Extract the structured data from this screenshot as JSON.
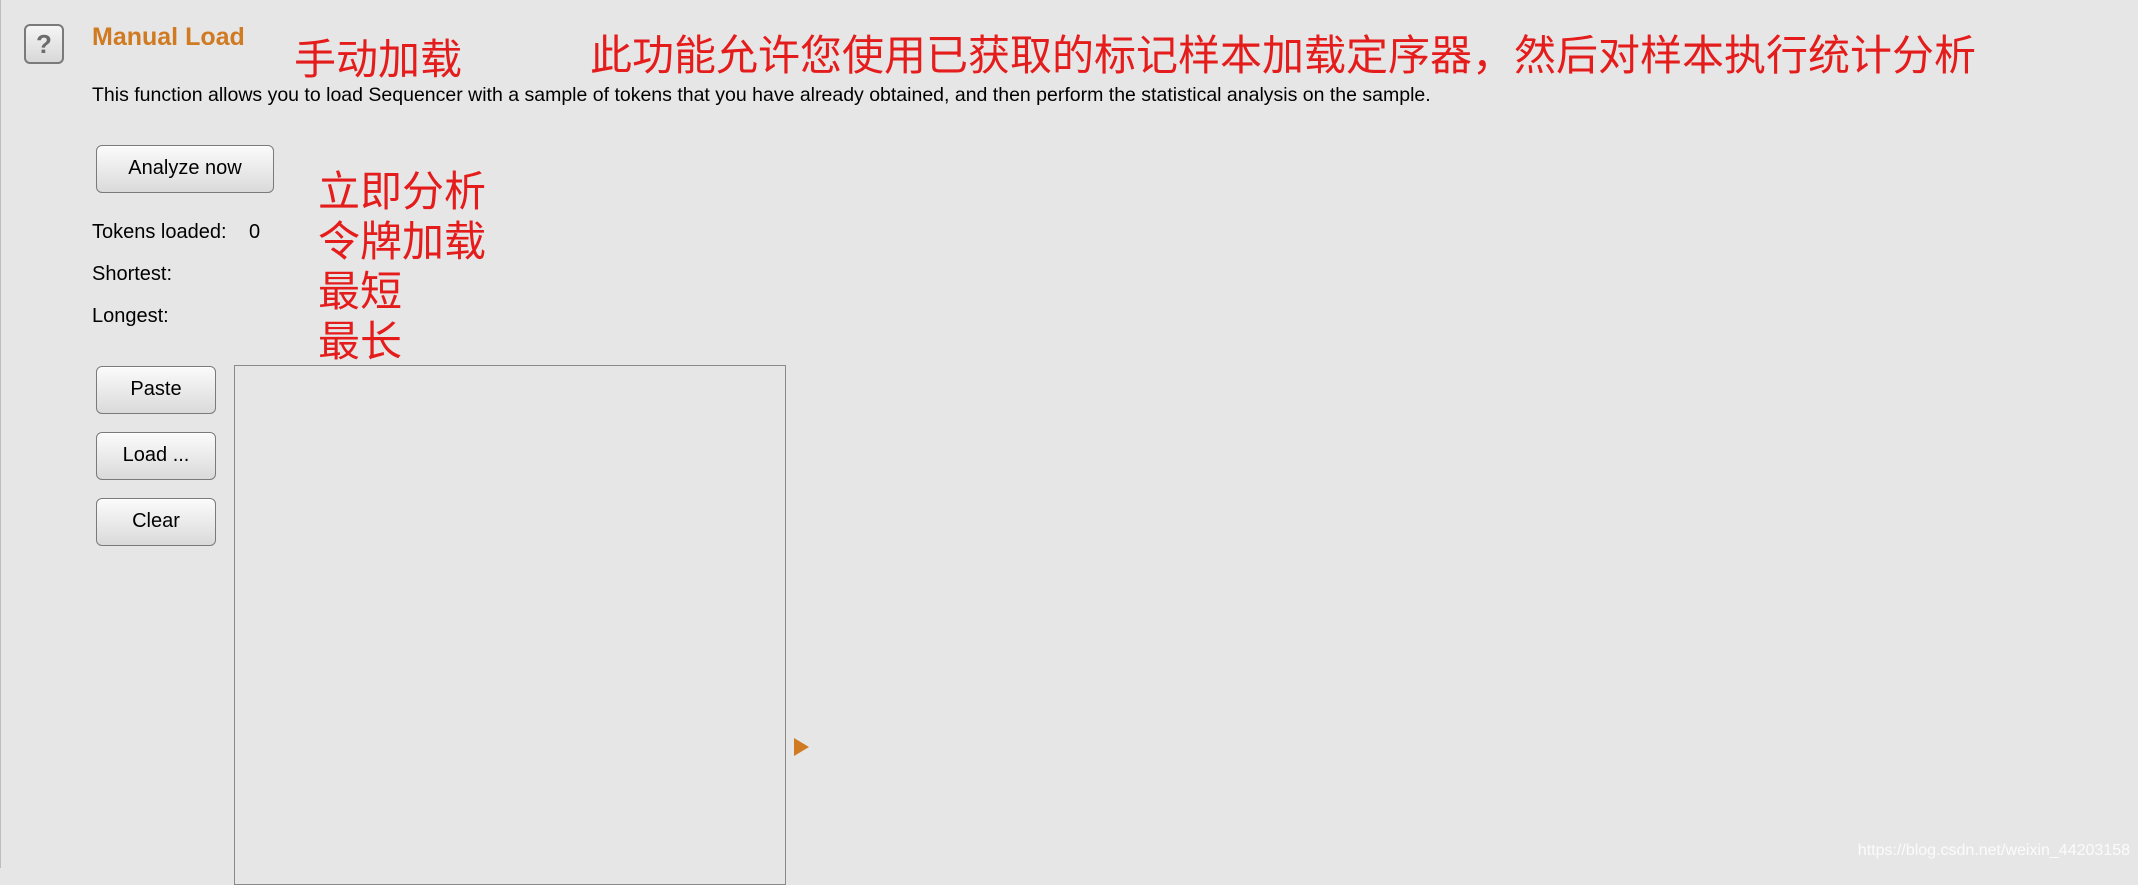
{
  "header": {
    "help_icon_glyph": "?",
    "title": "Manual Load",
    "title_color": "#d07a21",
    "description": "This function allows you to load Sequencer with a sample of tokens that you have already obtained, and then perform the statistical analysis on the sample."
  },
  "annotations": {
    "color": "#e51c1c",
    "title_cn": "手动加载",
    "desc_cn": "此功能允许您使用已获取的标记样本加载定序器，然后对样本执行统计分析",
    "analyze_cn": "立即分析",
    "tokens_cn": "令牌加载",
    "shortest_cn": "最短",
    "longest_cn": "最长"
  },
  "actions": {
    "analyze_label": "Analyze now",
    "paste_label": "Paste",
    "load_label": "Load ...",
    "clear_label": "Clear"
  },
  "stats": {
    "tokens_loaded_label": "Tokens loaded:",
    "tokens_loaded_value": "0",
    "shortest_label": "Shortest:",
    "shortest_value": "",
    "longest_label": "Longest:",
    "longest_value": ""
  },
  "token_list": {
    "items": []
  },
  "icons": {
    "help": "help-icon",
    "expand": "expand-arrow-icon"
  },
  "watermark": "https://blog.csdn.net/weixin_44203158"
}
